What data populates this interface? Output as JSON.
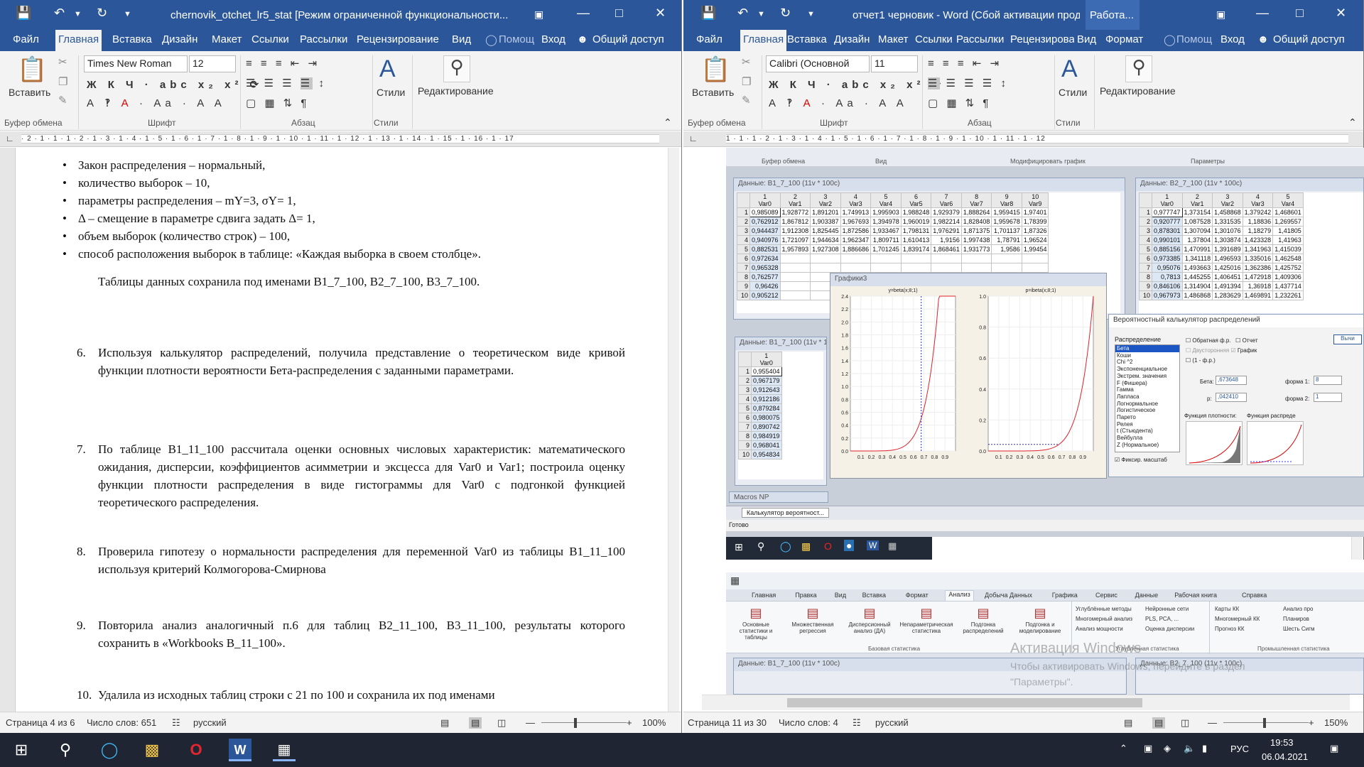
{
  "left_window": {
    "title": "chernovik_otchet_lr5_stat [Режим ограниченной функциональности...",
    "tabs": [
      "Файл",
      "Главная",
      "Вставка",
      "Дизайн",
      "Макет",
      "Ссылки",
      "Рассылки",
      "Рецензирование",
      "Вид",
      "Помощ",
      "Вход",
      "Общий доступ"
    ],
    "font_name": "Times New Roman",
    "font_size": "12",
    "ribbon": {
      "paste": "Вставить",
      "styles": "Стили",
      "editing": "Редактирование",
      "groups": [
        "Буфер обмена",
        "Шрифт",
        "Абзац",
        "Стили"
      ]
    },
    "ruler": "· 2 · 1 · 1 · 1 · 2 · 1 · 3 · 1 · 4 · 1 · 5 · 1 · 6 · 1 · 7 · 1 · 8 · 1 · 9 · 1 · 10 · 1 · 11 · 1 · 12 · 1 · 13 · 1 · 14 · 1 · 15 · 1 · 16 · 1 · 17",
    "doc": {
      "bullets": [
        "Закон распределения – нормальный,",
        "количество выборок – 10,",
        "параметры распределения – mY=3,   σY= 1,",
        " Δ – смещение в параметре сдвига задать Δ= 1,",
        "объем выборок (количество строк) – 100,",
        "способ расположения выборок в таблице: «Каждая выборка в своем столбце»."
      ],
      "saved_line": "Таблицы данных сохранила под именами B1_7_100, B2_7_100, B3_7_100.",
      "items": [
        {
          "num": "6.",
          "text": "Используя калькулятор распределений, получила представление о теоретическом виде кривой функции плотности вероятности Бета-распределения с заданными параметрами."
        },
        {
          "num": "7.",
          "text": "По таблице B1_11_100 рассчитала оценки основных числовых характеристик: математического ожидания, дисперсии, коэффициентов асимметрии и эксцесса для Var0 и Var1; построила оценку функции плотности распределения в виде гистограммы для Var0 с подгонкой функцией теоретического распределения."
        },
        {
          "num": "8.",
          "text": "Проверила гипотезу о нормальности распределения для переменной Var0 из таблицы B1_11_100 используя критерий Колмогорова-Смирнова"
        },
        {
          "num": "9.",
          "text": "Повторила анализ аналогичный п.6 для таблиц B2_11_100, B3_11_100, результаты которого сохранить в «Workbooks B_11_100»."
        },
        {
          "num": "10.",
          "text": "Удалила из исходных таблиц строки с 21 по 100 и сохранила их под именами"
        }
      ]
    },
    "status": {
      "page": "Страница 4 из 6",
      "words": "Число слов: 651",
      "lang": "русский",
      "zoom": "100%"
    }
  },
  "right_window": {
    "title": "отчет1 черновик - Word (Сбой активации проду...",
    "context": "Работа...",
    "tabs": [
      "Файл",
      "Главная",
      "Вставка",
      "Дизайн",
      "Макет",
      "Ссылки",
      "Рассылки",
      "Рецензирова",
      "Вид",
      "Формат",
      "Помощ",
      "Вход",
      "Общий доступ"
    ],
    "font_name": "Calibri (Основной",
    "font_size": "11",
    "ruler": "1 · 1 · 1 · 2 · 1 · 3 · 1 · 4 · 1 · 5 · 1 · 6 · 1 · 7 · 1 · 8 · 1 · 9 · 1 · 10 · 1 · 11 · 1 · 12",
    "status": {
      "page": "Страница 11 из 30",
      "words": "Число слов: 4",
      "lang": "русский",
      "zoom": "150%"
    },
    "shot1": {
      "top_labels": [
        "Буфер обмена",
        "Вид",
        "Модифицировать график",
        "Параметры"
      ],
      "table1_title": "Данные: B1_7_100 (11v * 100c)",
      "table2_title": "Данные: B2_7_100 (11v * 100c)",
      "table3_title": "Данные: B1_7_100 (11v * 100c)",
      "graph_title": "Графики3",
      "cols1": [
        "Var0",
        "Var1",
        "Var2",
        "Var3",
        "Var4",
        "Var5",
        "Var6",
        "Var7",
        "Var8",
        "Var9"
      ],
      "rows1": [
        [
          "0,985089",
          "1,928772",
          "1,891201",
          "1,749913",
          "1,995903",
          "1,988248",
          "1,929379",
          "1,888264",
          "1,959415",
          "1,97401"
        ],
        [
          "0,762912",
          "1,867812",
          "1,903387",
          "1,967693",
          "1,394978",
          "1,960019",
          "1,982214",
          "1,828408",
          "1,959678",
          "1,78399"
        ],
        [
          "0,944437",
          "1,912308",
          "1,825445",
          "1,872586",
          "1,933467",
          "1,798131",
          "1,976291",
          "1,871375",
          "1,701137",
          "1,87326"
        ],
        [
          "0,940976",
          "1,721097",
          "1,944634",
          "1,962347",
          "1,809711",
          "1,610413",
          "1,9156",
          "1,997438",
          "1,78791",
          "1,96524"
        ],
        [
          "0,882531",
          "1,957893",
          "1,927308",
          "1,886686",
          "1,701245",
          "1,839174",
          "1,868461",
          "1,931773",
          "1,9586",
          "1,99454"
        ],
        [
          "0,972634",
          "",
          "",
          "",
          "",
          "",
          "",
          "",
          "",
          ""
        ],
        [
          "0,965328",
          "",
          "",
          "",
          "",
          "",
          "",
          "",
          "",
          ""
        ],
        [
          "0,762577",
          "",
          "",
          "",
          "",
          "",
          "",
          "",
          "",
          ""
        ],
        [
          "0,96426",
          "",
          "",
          "",
          "",
          "",
          "",
          "",
          "",
          ""
        ],
        [
          "0,905212",
          "",
          "",
          "",
          "",
          "",
          "",
          "",
          "",
          ""
        ]
      ],
      "cols2": [
        "Var0",
        "Var1",
        "Var2",
        "Var3",
        "Var4"
      ],
      "rows2": [
        [
          "0,977747",
          "1,373154",
          "1,458868",
          "1,379242",
          "1,468601"
        ],
        [
          "0,920777",
          "1,087528",
          "1,331535",
          "1,18836",
          "1,269557"
        ],
        [
          "0,878301",
          "1,307094",
          "1,301076",
          "1,18279",
          "1,41805"
        ],
        [
          "0,990101",
          "1,37804",
          "1,303874",
          "1,423328",
          "1,41963"
        ],
        [
          "0,885156",
          "1,470991",
          "1,391689",
          "1,341963",
          "1,415039"
        ],
        [
          "0,973385",
          "1,341118",
          "1,496593",
          "1,335016",
          "1,462548"
        ],
        [
          "0,95076",
          "1,493663",
          "1,425016",
          "1,362386",
          "1,425752"
        ],
        [
          "0,7813",
          "1,445255",
          "1,406451",
          "1,472918",
          "1,409306"
        ],
        [
          "0,846106",
          "1,314904",
          "1,491394",
          "1,36918",
          "1,437714"
        ],
        [
          "0,967973",
          "1,486868",
          "1,283629",
          "1,469891",
          "1,232261"
        ]
      ],
      "rows3": [
        "0,955404",
        "0,967179",
        "0,912643",
        "0,912186",
        "0,879284",
        "0,980075",
        "0,890742",
        "0,984919",
        "0,968041",
        "0,954834"
      ],
      "plot1_title": "y=beta(x;8;1)",
      "plot2_title": "p=ibeta(x;8;1)",
      "plot1_yticks": [
        "2.4",
        "2.2",
        "2.0",
        "1.8",
        "1.6",
        "1.4",
        "1.2",
        "1.0",
        "0.8",
        "0.6",
        "0.4",
        "0.2",
        "0.0"
      ],
      "plot2_yticks": [
        "1.0",
        "0.8",
        "0.6",
        "0.4",
        "0.2",
        "0.0"
      ],
      "xticks": [
        "0.1",
        "0.2",
        "0.3",
        "0.4",
        "0.5",
        "0.6",
        "0.7",
        "0.8",
        "0.9"
      ],
      "calc": {
        "title": "Вероятностный калькулятор распределений",
        "dist_label": "Распределение",
        "dists": [
          "Бета",
          "Коши",
          "Chi ^2",
          "Экспоненциальное",
          "Экстрем. значения",
          "F (Фишера)",
          "Гамма",
          "Лапласа",
          "Логнормальное",
          "Логистическое",
          "Парето",
          "Релея",
          "t (Стьюдента)",
          "Вейбулла",
          "Z (Нормальное)"
        ],
        "checks": [
          "Обратная ф.р.",
          "Отчет",
          "Двусторонняя",
          "График",
          "(1 - ф.р.)"
        ],
        "beta_label": "Бета:",
        "beta_val": ",673648",
        "p_label": "p:",
        "p_val": ",042410",
        "shape1_label": "форма 1:",
        "shape1_val": "8",
        "shape2_label": "форма 2:",
        "shape2_val": "1",
        "density_label": "Функция плотности:",
        "cdf_label": "Функция распреде",
        "fix_scale": "Фиксир. масштаб",
        "calc_btn": "Вычи"
      },
      "macros": "Macros NP",
      "taskbar_item": "Калькулятор вероятност...",
      "ready": "Готово"
    },
    "shot2": {
      "tabs": [
        "Главная",
        "Правка",
        "Вид",
        "Вставка",
        "Формат",
        "Анализ",
        "Добыча Данных",
        "Графика",
        "Сервис",
        "Данные",
        "Рабочая книга",
        "Справка"
      ],
      "buttons": [
        "Основные статистики и таблицы",
        "Множественная регрессия",
        "Дисперсионный анализ (ДА)",
        "Непараметрическая статистика",
        "Подгонка распределений",
        "Подгонка и моделирование"
      ],
      "group1": "Базовая статистика",
      "adv": [
        "Углублённые методы",
        "Многомерный анализ",
        "Анализ мощности"
      ],
      "adv2": [
        "Нейронные сети",
        "PLS, PCA, ...",
        "Оценка дисперсии"
      ],
      "group2": "Углублённая статистика",
      "ind": [
        "Карты КК",
        "Многомерный КК",
        "Прогноз КК"
      ],
      "ind2": [
        "Анализ про",
        "Планиров",
        "Шесть Сигм"
      ],
      "group3": "Промышленная статистика",
      "activation1": "Активация Windows",
      "activation2": "Чтобы активировать Windows, перейдите в раздел",
      "activation3": "\"Параметры\".",
      "t1": "Данные: B1_7_100 (11v * 100c)",
      "t2": "Данные: B2_7_100 (11v * 100c)"
    }
  },
  "taskbar": {
    "lang": "РУС",
    "time": "19:53",
    "date": "06.04.2021"
  }
}
